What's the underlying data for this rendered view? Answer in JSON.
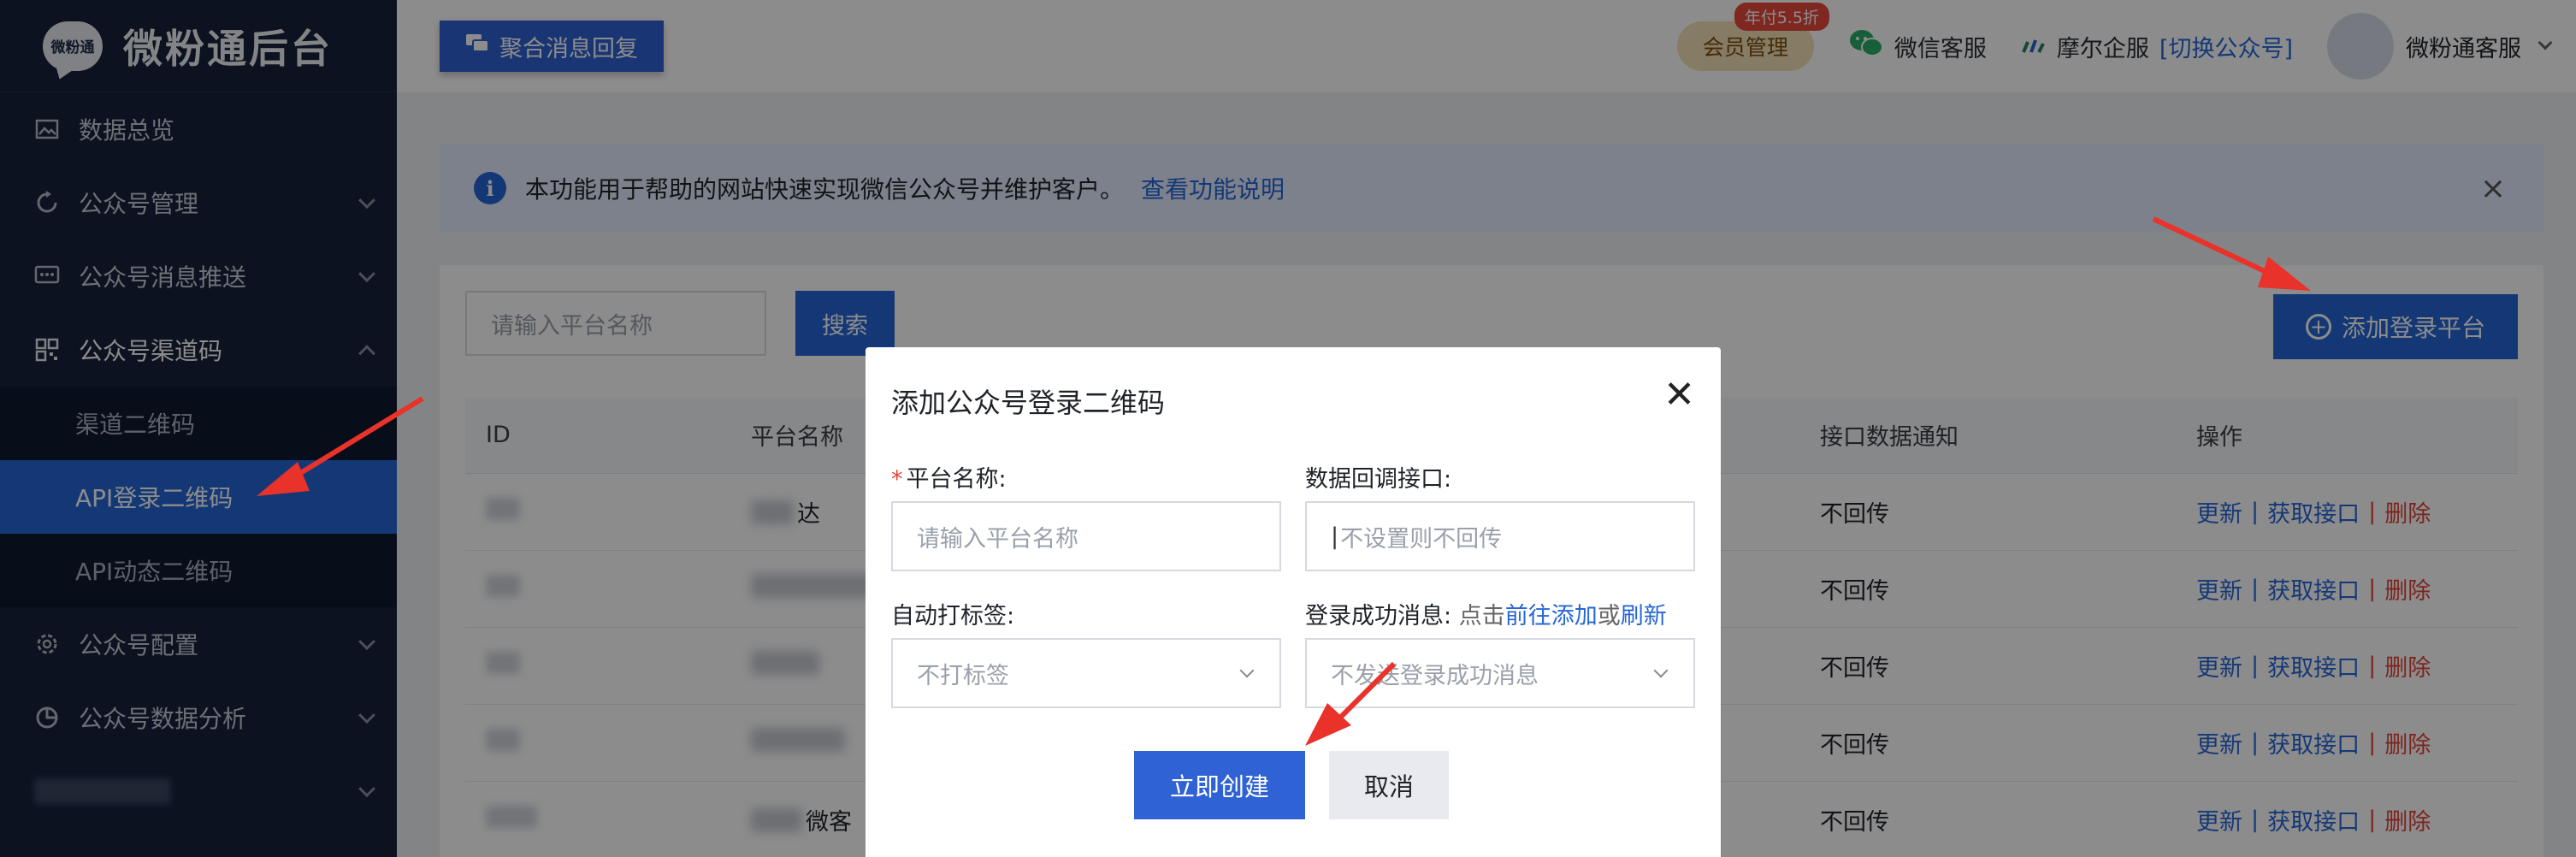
{
  "sidebar": {
    "logo_badge": "微粉通",
    "logo_title": "微粉通后台",
    "items": [
      {
        "label": "数据总览"
      },
      {
        "label": "公众号管理"
      },
      {
        "label": "公众号消息推送"
      },
      {
        "label": "公众号渠道码"
      },
      {
        "label": "公众号配置"
      },
      {
        "label": "公众号数据分析"
      }
    ],
    "sub_items": [
      {
        "label": "渠道二维码"
      },
      {
        "label": "API登录二维码"
      },
      {
        "label": "API动态二维码"
      }
    ]
  },
  "header": {
    "aggregate_button": "聚合消息回复",
    "member_label": "会员管理",
    "member_badge": "年付5.5折",
    "wechat_service": "微信客服",
    "company": "摩尔企服",
    "switch_account": "[切换公众号]",
    "user_name": "微粉通客服"
  },
  "notice": {
    "text": "本功能用于帮助的网站快速实现微信公众号并维护客户。",
    "link": "查看功能说明"
  },
  "toolbar": {
    "search_placeholder": "请输入平台名称",
    "search_button": "搜索",
    "add_button": "添加登录平台"
  },
  "table": {
    "headers": {
      "id": "ID",
      "name": "平台名称",
      "notify": "接口数据通知",
      "ops": "操作"
    },
    "rows": [
      {
        "name_visible": "达",
        "notify": "不回传"
      },
      {
        "name_visible": "",
        "notify": "不回传"
      },
      {
        "name_visible": "",
        "notify": "不回传"
      },
      {
        "name_visible": "",
        "notify": "不回传"
      },
      {
        "name_visible": "微客",
        "notify": "不回传"
      }
    ],
    "ops": {
      "update": "更新",
      "get_api": "获取接口",
      "delete": "删除",
      "sep": "|"
    }
  },
  "modal": {
    "title": "添加公众号登录二维码",
    "platform_name_label": "平台名称:",
    "platform_name_placeholder": "请输入平台名称",
    "callback_label": "数据回调接口:",
    "callback_placeholder": "不设置则不回传",
    "auto_tag_label": "自动打标签:",
    "auto_tag_value": "不打标签",
    "success_msg_label": "登录成功消息:",
    "success_msg_hint_prefix": "点击",
    "success_msg_hint_add": "前往添加",
    "success_msg_hint_or": "或",
    "success_msg_hint_refresh": "刷新",
    "success_msg_value": "不发送登录成功消息",
    "create_button": "立即创建",
    "cancel_button": "取消"
  },
  "colors": {
    "sidebar_bg": "#16213b",
    "accent": "#2566d8",
    "danger": "#e0443a",
    "arrow": "#e8322a"
  }
}
